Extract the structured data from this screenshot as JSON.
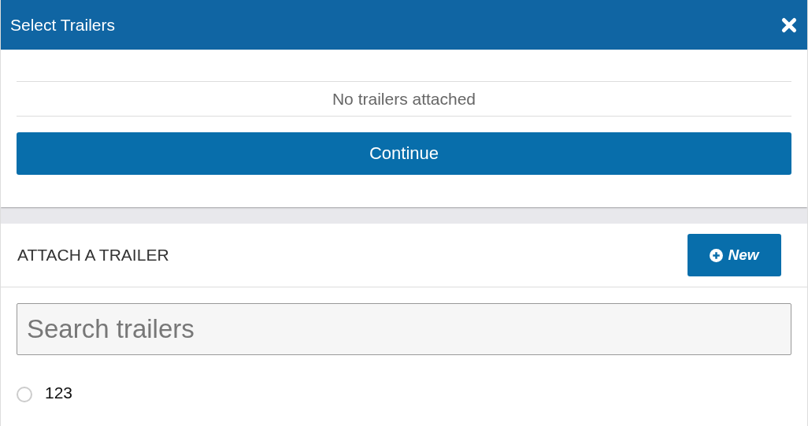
{
  "dialog": {
    "title": "Select Trailers"
  },
  "attached": {
    "message": "No trailers attached"
  },
  "continue_button": {
    "label": "Continue"
  },
  "attach_section": {
    "heading": "ATTACH A TRAILER",
    "new_button": {
      "label": "New"
    }
  },
  "search": {
    "placeholder": "Search trailers"
  },
  "trailers": [
    {
      "label": "123",
      "selected": false
    }
  ]
}
